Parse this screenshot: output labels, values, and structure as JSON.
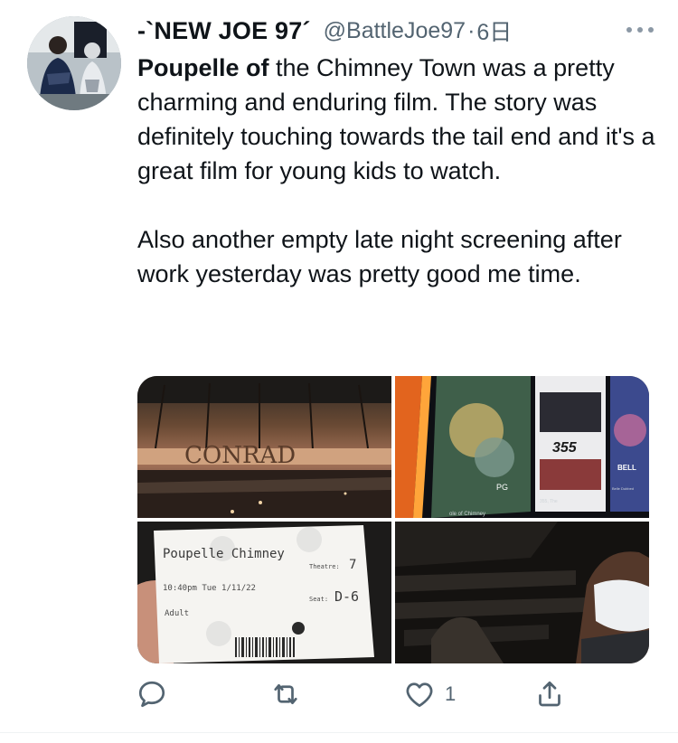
{
  "tweet": {
    "display_name": "-`NEW JOE 97´",
    "handle": "@BattleJoe97",
    "separator": "·",
    "time": "6日",
    "text_bold": "Poupelle of",
    "text_rest": " the Chimney Town was a pretty charming and enduring film. The story was definitely touching towards the tail end and it's a great film for young kids to watch.\n\nAlso another empty late night screening after work yesterday was pretty good me time."
  },
  "media": {
    "photo1": {
      "sign_text": "CONRAD"
    },
    "photo2": {
      "poster_number": "355",
      "poster_label": "BELL",
      "rating": "PG",
      "caption_left": "ole of Chimney",
      "caption_mid": "355, The",
      "caption_right": "Belle Dubbed"
    },
    "photo3": {
      "ticket_title": "Poupelle Chimney",
      "ticket_theatre_label": "Theatre:",
      "ticket_theatre": "7",
      "ticket_time": "10:40pm Tue 1/11/22",
      "ticket_seat_label": "Seat:",
      "ticket_seat": "D-6",
      "ticket_type": "Adult"
    }
  },
  "actions": {
    "reply_count": "",
    "retweet_count": "",
    "like_count": "1",
    "share_count": ""
  },
  "colors": {
    "text_primary": "#0f1419",
    "text_secondary": "#536471"
  }
}
